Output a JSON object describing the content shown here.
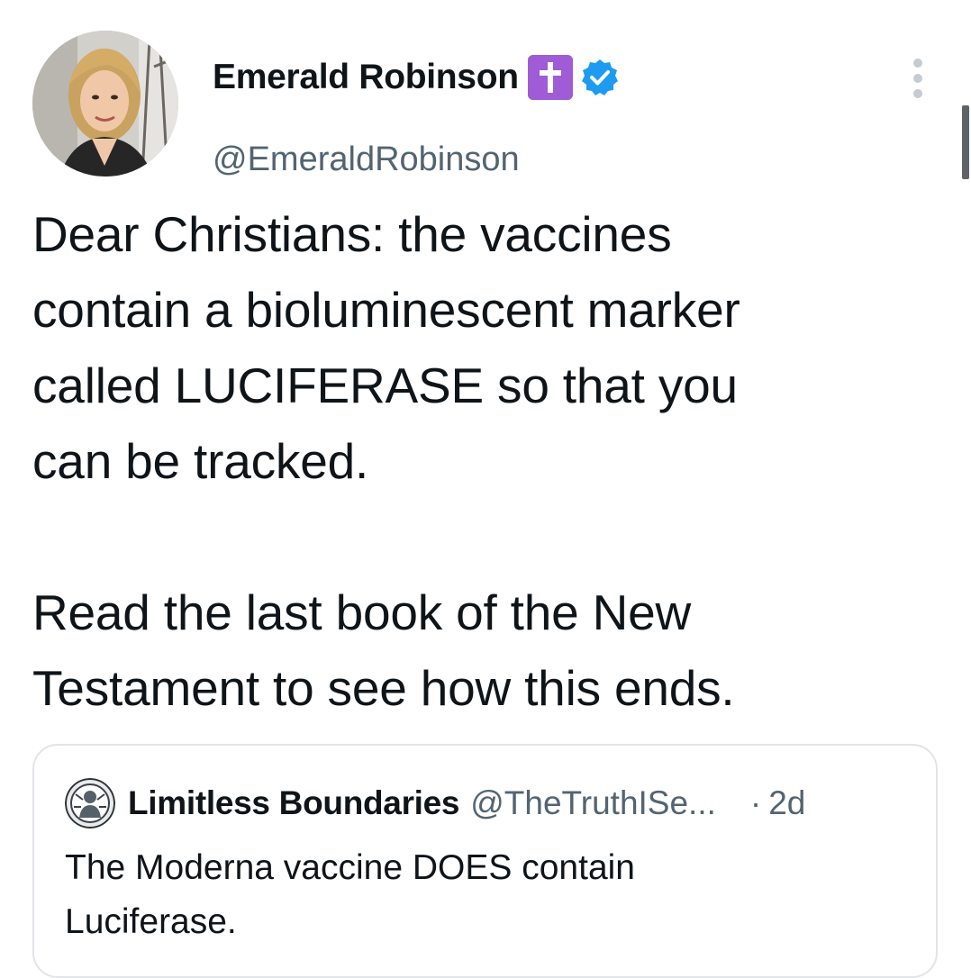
{
  "author": {
    "display_name": "Emerald Robinson",
    "handle": "@EmeraldRobinson",
    "name_emoji": "latin-cross-emoji",
    "verified": true
  },
  "tweet": {
    "lines_p1": [
      "Dear Christians: the vaccines",
      "contain a bioluminescent marker",
      "called LUCIFERASE so that you",
      "can be tracked."
    ],
    "lines_p2": [
      "Read the last book of the New",
      "Testament to see how this ends."
    ]
  },
  "quoted": {
    "display_name": "Limitless Boundaries",
    "handle": "@TheTruthISe...",
    "separator": "·",
    "time": "2d",
    "lines": [
      "The Moderna vaccine DOES contain",
      "Luciferase."
    ]
  },
  "colors": {
    "text": "#0f1419",
    "secondary": "#536471",
    "verified": "#1d9bf0",
    "emoji_purple": "#a05bd6",
    "border": "#e1e5e8"
  }
}
